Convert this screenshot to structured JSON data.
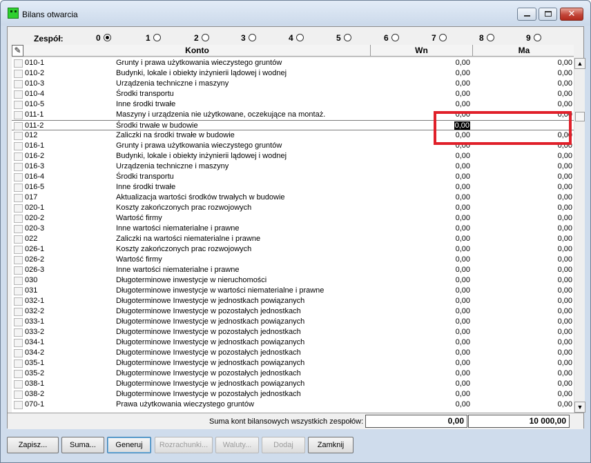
{
  "window": {
    "title": "Bilans otwarcia"
  },
  "zespol": {
    "label": "Zespół:",
    "options": [
      {
        "label": "0",
        "selected": true
      },
      {
        "label": "1",
        "selected": false
      },
      {
        "label": "2",
        "selected": false
      },
      {
        "label": "3",
        "selected": false
      },
      {
        "label": "4",
        "selected": false
      },
      {
        "label": "5",
        "selected": false
      },
      {
        "label": "6",
        "selected": false
      },
      {
        "label": "7",
        "selected": false
      },
      {
        "label": "8",
        "selected": false
      },
      {
        "label": "9",
        "selected": false
      }
    ]
  },
  "columns": {
    "konto": "Konto",
    "wn": "Wn",
    "ma": "Ma"
  },
  "rows": [
    {
      "kod": "010-1",
      "name": "Grunty i prawa użytkowania wieczystego gruntów",
      "wn": "0,00",
      "ma": "0,00"
    },
    {
      "kod": "010-2",
      "name": "Budynki, lokale i obiekty inżynierii lądowej i wodnej",
      "wn": "0,00",
      "ma": "0,00"
    },
    {
      "kod": "010-3",
      "name": "Urządzenia techniczne i maszyny",
      "wn": "0,00",
      "ma": "0,00"
    },
    {
      "kod": "010-4",
      "name": "Środki transportu",
      "wn": "0,00",
      "ma": "0,00"
    },
    {
      "kod": "010-5",
      "name": "Inne środki trwałe",
      "wn": "0,00",
      "ma": "0,00"
    },
    {
      "kod": "011-1",
      "name": "Maszyny i urządzenia nie użytkowane, oczekujące na montaż.",
      "wn": "0,00",
      "ma": "0,00"
    },
    {
      "kod": "011-2",
      "name": "Środki trwałe w budowie",
      "wn": "0,00",
      "ma": ""
    },
    {
      "kod": "012",
      "name": "Zaliczki na środki trwałe w budowie",
      "wn": "0,00",
      "ma": "0,00"
    },
    {
      "kod": "016-1",
      "name": "Grunty i prawa użytkowania wieczystego gruntów",
      "wn": "0,00",
      "ma": "0,00"
    },
    {
      "kod": "016-2",
      "name": "Budynki, lokale i obiekty inżynierii lądowej i wodnej",
      "wn": "0,00",
      "ma": "0,00"
    },
    {
      "kod": "016-3",
      "name": "Urządzenia techniczne i maszyny",
      "wn": "0,00",
      "ma": "0,00"
    },
    {
      "kod": "016-4",
      "name": "Środki transportu",
      "wn": "0,00",
      "ma": "0,00"
    },
    {
      "kod": "016-5",
      "name": "Inne środki trwałe",
      "wn": "0,00",
      "ma": "0,00"
    },
    {
      "kod": "017",
      "name": "Aktualizacja wartości środków trwałych w budowie",
      "wn": "0,00",
      "ma": "0,00"
    },
    {
      "kod": "020-1",
      "name": "Koszty zakończonych prac rozwojowych",
      "wn": "0,00",
      "ma": "0,00"
    },
    {
      "kod": "020-2",
      "name": "Wartość firmy",
      "wn": "0,00",
      "ma": "0,00"
    },
    {
      "kod": "020-3",
      "name": "Inne wartości niematerialne i prawne",
      "wn": "0,00",
      "ma": "0,00"
    },
    {
      "kod": "022",
      "name": "Zaliczki na wartości niematerialne i prawne",
      "wn": "0,00",
      "ma": "0,00"
    },
    {
      "kod": "026-1",
      "name": "Koszty zakończonych prac rozwojowych",
      "wn": "0,00",
      "ma": "0,00"
    },
    {
      "kod": "026-2",
      "name": "Wartość firmy",
      "wn": "0,00",
      "ma": "0,00"
    },
    {
      "kod": "026-3",
      "name": "Inne wartości niematerialne i prawne",
      "wn": "0,00",
      "ma": "0,00"
    },
    {
      "kod": "030",
      "name": "Długoterminowe inwestycje w nieruchomości",
      "wn": "0,00",
      "ma": "0,00"
    },
    {
      "kod": "031",
      "name": "Długoterminowe inwestycje w wartości niematerialne i prawne",
      "wn": "0,00",
      "ma": "0,00"
    },
    {
      "kod": "032-1",
      "name": "Długoterminowe Inwestycje w jednostkach powiązanych",
      "wn": "0,00",
      "ma": "0,00"
    },
    {
      "kod": "032-2",
      "name": "Długoterminowe Inwestycje w pozostałych jednostkach",
      "wn": "0,00",
      "ma": "0,00"
    },
    {
      "kod": "033-1",
      "name": "Długoterminowe Inwestycje w jednostkach powiązanych",
      "wn": "0,00",
      "ma": "0,00"
    },
    {
      "kod": "033-2",
      "name": "Długoterminowe Inwestycje w pozostałych jednostkach",
      "wn": "0,00",
      "ma": "0,00"
    },
    {
      "kod": "034-1",
      "name": "Długoterminowe Inwestycje w jednostkach powiązanych",
      "wn": "0,00",
      "ma": "0,00"
    },
    {
      "kod": "034-2",
      "name": "Długoterminowe Inwestycje w pozostałych jednostkach",
      "wn": "0,00",
      "ma": "0,00"
    },
    {
      "kod": "035-1",
      "name": "Długoterminowe Inwestycje w jednostkach powiązanych",
      "wn": "0,00",
      "ma": "0,00"
    },
    {
      "kod": "035-2",
      "name": "Długoterminowe Inwestycje w pozostałych jednostkach",
      "wn": "0,00",
      "ma": "0,00"
    },
    {
      "kod": "038-1",
      "name": "Długoterminowe Inwestycje w jednostkach powiązanych",
      "wn": "0,00",
      "ma": "0,00"
    },
    {
      "kod": "038-2",
      "name": "Długoterminowe Inwestycje w pozostałych jednostkach",
      "wn": "0,00",
      "ma": "0,00"
    },
    {
      "kod": "070-1",
      "name": "Prawa użytkowania wieczystego gruntów",
      "wn": "0,00",
      "ma": "0,00"
    }
  ],
  "current_row": 6,
  "editing_value": "0,00",
  "summary": {
    "label": "Suma kont bilansowych wszystkich zespołów:",
    "wn": "0,00",
    "ma": "10 000,00"
  },
  "buttons": [
    {
      "label": "Zapisz...",
      "enabled": true,
      "default": false
    },
    {
      "label": "Suma...",
      "enabled": true,
      "default": false
    },
    {
      "label": "Generuj",
      "enabled": true,
      "default": true
    },
    {
      "label": "Rozrachunki...",
      "enabled": false,
      "default": false
    },
    {
      "label": "Waluty...",
      "enabled": false,
      "default": false
    },
    {
      "label": "Dodaj",
      "enabled": false,
      "default": false
    },
    {
      "label": "Zamknij",
      "enabled": true,
      "default": false
    }
  ],
  "colors": {
    "highlight": "#e0202a",
    "titlebar": "#cfdcec"
  }
}
